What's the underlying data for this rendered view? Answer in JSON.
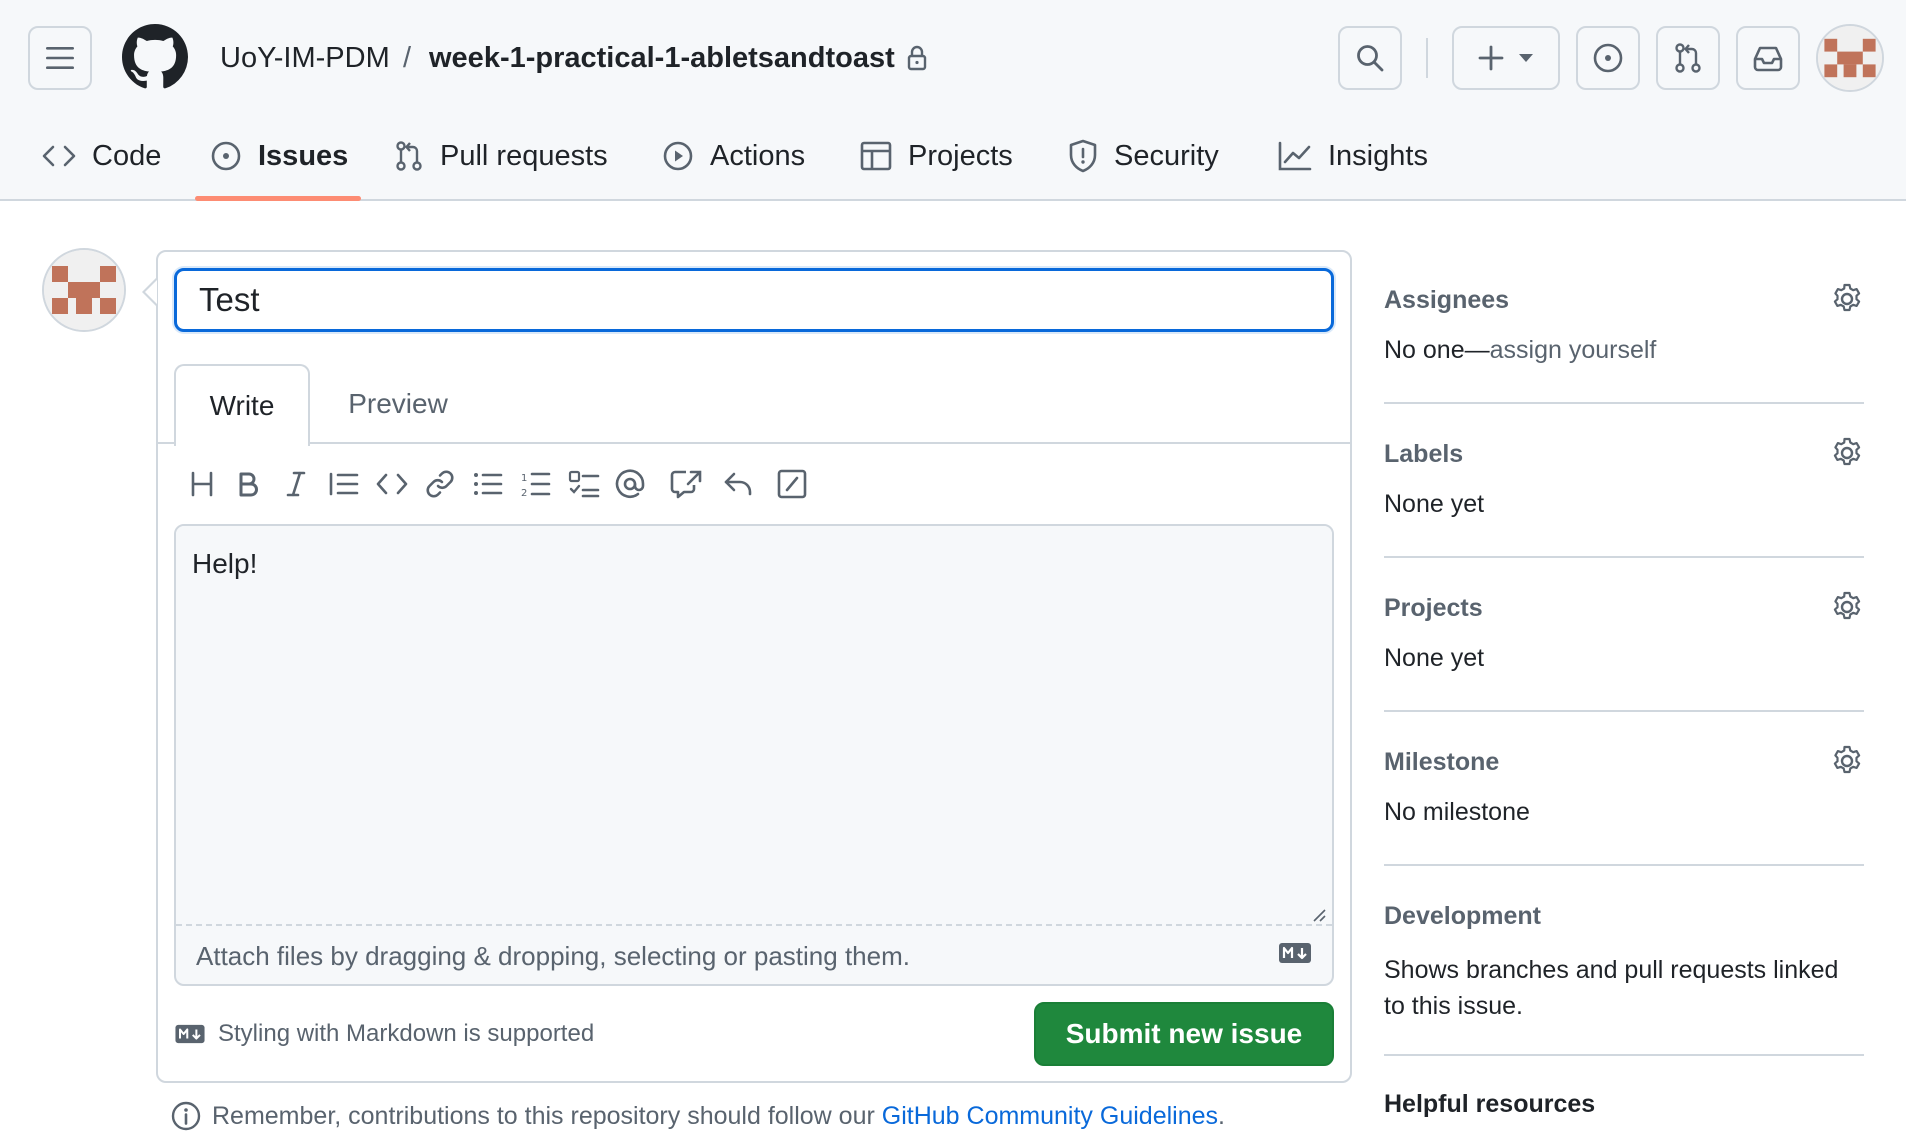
{
  "header": {
    "owner": "UoY-IM-PDM",
    "separator": "/",
    "repo": "week-1-practical-1-abletsandtoast"
  },
  "tabs": [
    {
      "label": "Code",
      "icon": "code-icon"
    },
    {
      "label": "Issues",
      "icon": "issue-opened-icon",
      "active": true
    },
    {
      "label": "Pull requests",
      "icon": "git-pull-request-icon"
    },
    {
      "label": "Actions",
      "icon": "play-icon"
    },
    {
      "label": "Projects",
      "icon": "table-icon"
    },
    {
      "label": "Security",
      "icon": "shield-icon"
    },
    {
      "label": "Insights",
      "icon": "graph-icon"
    }
  ],
  "form": {
    "title_value": "Test",
    "write_tab": "Write",
    "preview_tab": "Preview",
    "body_value": "Help!",
    "attach_text": "Attach files by dragging & dropping, selecting or pasting them.",
    "markdown_note": "Styling with Markdown is supported",
    "submit_label": "Submit new issue"
  },
  "footer": {
    "remember_text": "Remember, contributions to this repository should follow our ",
    "guidelines_link": "GitHub Community Guidelines",
    "period": "."
  },
  "sidebar": {
    "assignees": {
      "title": "Assignees",
      "value_prefix": "No one—",
      "value_link": "assign yourself"
    },
    "labels": {
      "title": "Labels",
      "value": "None yet"
    },
    "projects": {
      "title": "Projects",
      "value": "None yet"
    },
    "milestone": {
      "title": "Milestone",
      "value": "No milestone"
    },
    "development": {
      "title": "Development",
      "value": "Shows branches and pull requests linked to this issue."
    },
    "helpful": "Helpful resources"
  },
  "colors": {
    "accent": "#0969da",
    "submit": "#1f883d",
    "tab_underline": "#fd8c73",
    "identicon": "#c0735a"
  }
}
